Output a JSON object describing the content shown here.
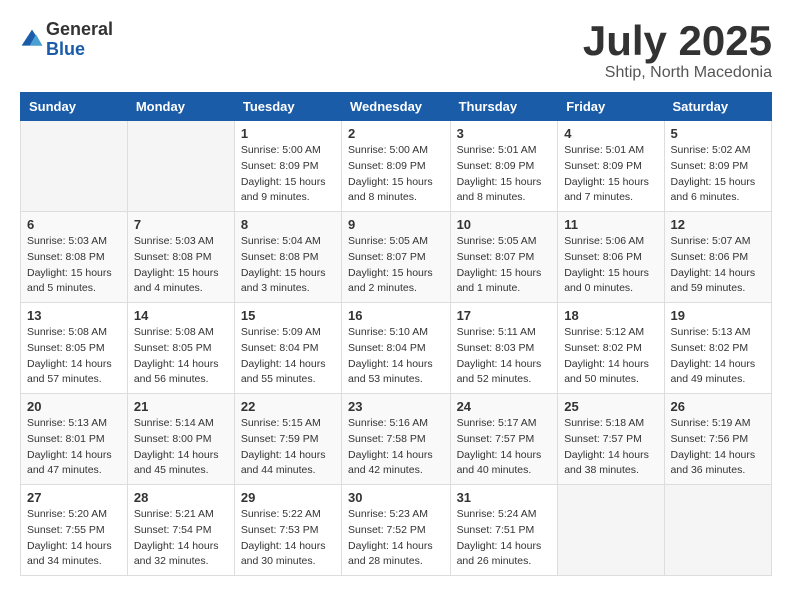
{
  "logo": {
    "general": "General",
    "blue": "Blue"
  },
  "title": "July 2025",
  "location": "Shtip, North Macedonia",
  "days_header": [
    "Sunday",
    "Monday",
    "Tuesday",
    "Wednesday",
    "Thursday",
    "Friday",
    "Saturday"
  ],
  "weeks": [
    [
      {
        "day": "",
        "sunrise": "",
        "sunset": "",
        "daylight": ""
      },
      {
        "day": "",
        "sunrise": "",
        "sunset": "",
        "daylight": ""
      },
      {
        "day": "1",
        "sunrise": "Sunrise: 5:00 AM",
        "sunset": "Sunset: 8:09 PM",
        "daylight": "Daylight: 15 hours and 9 minutes."
      },
      {
        "day": "2",
        "sunrise": "Sunrise: 5:00 AM",
        "sunset": "Sunset: 8:09 PM",
        "daylight": "Daylight: 15 hours and 8 minutes."
      },
      {
        "day": "3",
        "sunrise": "Sunrise: 5:01 AM",
        "sunset": "Sunset: 8:09 PM",
        "daylight": "Daylight: 15 hours and 8 minutes."
      },
      {
        "day": "4",
        "sunrise": "Sunrise: 5:01 AM",
        "sunset": "Sunset: 8:09 PM",
        "daylight": "Daylight: 15 hours and 7 minutes."
      },
      {
        "day": "5",
        "sunrise": "Sunrise: 5:02 AM",
        "sunset": "Sunset: 8:09 PM",
        "daylight": "Daylight: 15 hours and 6 minutes."
      }
    ],
    [
      {
        "day": "6",
        "sunrise": "Sunrise: 5:03 AM",
        "sunset": "Sunset: 8:08 PM",
        "daylight": "Daylight: 15 hours and 5 minutes."
      },
      {
        "day": "7",
        "sunrise": "Sunrise: 5:03 AM",
        "sunset": "Sunset: 8:08 PM",
        "daylight": "Daylight: 15 hours and 4 minutes."
      },
      {
        "day": "8",
        "sunrise": "Sunrise: 5:04 AM",
        "sunset": "Sunset: 8:08 PM",
        "daylight": "Daylight: 15 hours and 3 minutes."
      },
      {
        "day": "9",
        "sunrise": "Sunrise: 5:05 AM",
        "sunset": "Sunset: 8:07 PM",
        "daylight": "Daylight: 15 hours and 2 minutes."
      },
      {
        "day": "10",
        "sunrise": "Sunrise: 5:05 AM",
        "sunset": "Sunset: 8:07 PM",
        "daylight": "Daylight: 15 hours and 1 minute."
      },
      {
        "day": "11",
        "sunrise": "Sunrise: 5:06 AM",
        "sunset": "Sunset: 8:06 PM",
        "daylight": "Daylight: 15 hours and 0 minutes."
      },
      {
        "day": "12",
        "sunrise": "Sunrise: 5:07 AM",
        "sunset": "Sunset: 8:06 PM",
        "daylight": "Daylight: 14 hours and 59 minutes."
      }
    ],
    [
      {
        "day": "13",
        "sunrise": "Sunrise: 5:08 AM",
        "sunset": "Sunset: 8:05 PM",
        "daylight": "Daylight: 14 hours and 57 minutes."
      },
      {
        "day": "14",
        "sunrise": "Sunrise: 5:08 AM",
        "sunset": "Sunset: 8:05 PM",
        "daylight": "Daylight: 14 hours and 56 minutes."
      },
      {
        "day": "15",
        "sunrise": "Sunrise: 5:09 AM",
        "sunset": "Sunset: 8:04 PM",
        "daylight": "Daylight: 14 hours and 55 minutes."
      },
      {
        "day": "16",
        "sunrise": "Sunrise: 5:10 AM",
        "sunset": "Sunset: 8:04 PM",
        "daylight": "Daylight: 14 hours and 53 minutes."
      },
      {
        "day": "17",
        "sunrise": "Sunrise: 5:11 AM",
        "sunset": "Sunset: 8:03 PM",
        "daylight": "Daylight: 14 hours and 52 minutes."
      },
      {
        "day": "18",
        "sunrise": "Sunrise: 5:12 AM",
        "sunset": "Sunset: 8:02 PM",
        "daylight": "Daylight: 14 hours and 50 minutes."
      },
      {
        "day": "19",
        "sunrise": "Sunrise: 5:13 AM",
        "sunset": "Sunset: 8:02 PM",
        "daylight": "Daylight: 14 hours and 49 minutes."
      }
    ],
    [
      {
        "day": "20",
        "sunrise": "Sunrise: 5:13 AM",
        "sunset": "Sunset: 8:01 PM",
        "daylight": "Daylight: 14 hours and 47 minutes."
      },
      {
        "day": "21",
        "sunrise": "Sunrise: 5:14 AM",
        "sunset": "Sunset: 8:00 PM",
        "daylight": "Daylight: 14 hours and 45 minutes."
      },
      {
        "day": "22",
        "sunrise": "Sunrise: 5:15 AM",
        "sunset": "Sunset: 7:59 PM",
        "daylight": "Daylight: 14 hours and 44 minutes."
      },
      {
        "day": "23",
        "sunrise": "Sunrise: 5:16 AM",
        "sunset": "Sunset: 7:58 PM",
        "daylight": "Daylight: 14 hours and 42 minutes."
      },
      {
        "day": "24",
        "sunrise": "Sunrise: 5:17 AM",
        "sunset": "Sunset: 7:57 PM",
        "daylight": "Daylight: 14 hours and 40 minutes."
      },
      {
        "day": "25",
        "sunrise": "Sunrise: 5:18 AM",
        "sunset": "Sunset: 7:57 PM",
        "daylight": "Daylight: 14 hours and 38 minutes."
      },
      {
        "day": "26",
        "sunrise": "Sunrise: 5:19 AM",
        "sunset": "Sunset: 7:56 PM",
        "daylight": "Daylight: 14 hours and 36 minutes."
      }
    ],
    [
      {
        "day": "27",
        "sunrise": "Sunrise: 5:20 AM",
        "sunset": "Sunset: 7:55 PM",
        "daylight": "Daylight: 14 hours and 34 minutes."
      },
      {
        "day": "28",
        "sunrise": "Sunrise: 5:21 AM",
        "sunset": "Sunset: 7:54 PM",
        "daylight": "Daylight: 14 hours and 32 minutes."
      },
      {
        "day": "29",
        "sunrise": "Sunrise: 5:22 AM",
        "sunset": "Sunset: 7:53 PM",
        "daylight": "Daylight: 14 hours and 30 minutes."
      },
      {
        "day": "30",
        "sunrise": "Sunrise: 5:23 AM",
        "sunset": "Sunset: 7:52 PM",
        "daylight": "Daylight: 14 hours and 28 minutes."
      },
      {
        "day": "31",
        "sunrise": "Sunrise: 5:24 AM",
        "sunset": "Sunset: 7:51 PM",
        "daylight": "Daylight: 14 hours and 26 minutes."
      },
      {
        "day": "",
        "sunrise": "",
        "sunset": "",
        "daylight": ""
      },
      {
        "day": "",
        "sunrise": "",
        "sunset": "",
        "daylight": ""
      }
    ]
  ]
}
